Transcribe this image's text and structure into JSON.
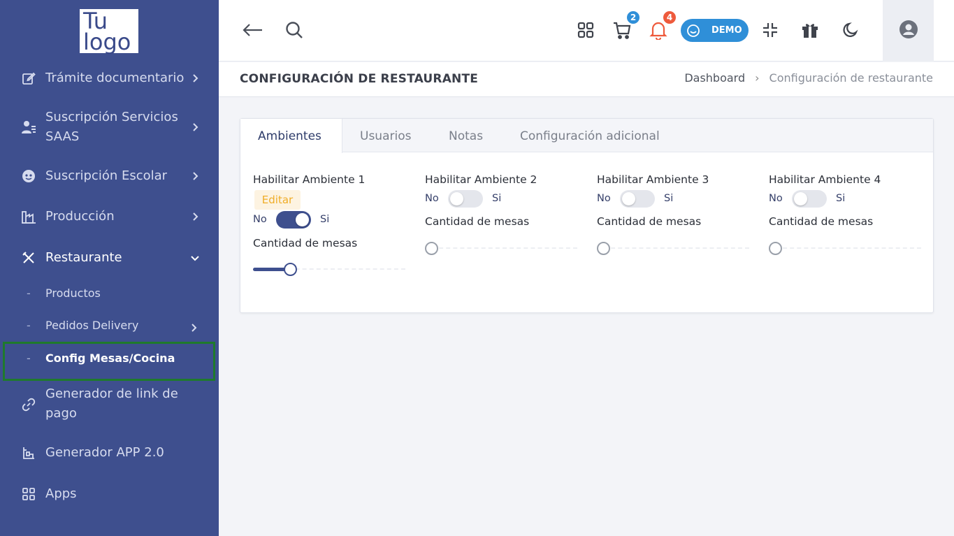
{
  "brand": {
    "logo_line1": "Tu",
    "logo_line2": "logo"
  },
  "sidebar": {
    "items": [
      {
        "label": "Trámite documentario",
        "icon": "edit-document-icon"
      },
      {
        "label": "Suscripción Servicios SAAS",
        "icon": "user-list-icon"
      },
      {
        "label": "Suscripción Escolar",
        "icon": "student-icon"
      },
      {
        "label": "Producción",
        "icon": "factory-icon"
      },
      {
        "label": "Restaurante",
        "icon": "fork-knife-icon"
      },
      {
        "label": "Generador de link de pago",
        "icon": "link-icon"
      },
      {
        "label": "Generador APP 2.0",
        "icon": "app-builder-icon"
      },
      {
        "label": "Apps",
        "icon": "apps-grid-icon"
      }
    ],
    "sub_items": [
      {
        "label": "Productos"
      },
      {
        "label": "Pedidos Delivery"
      },
      {
        "label": "Config Mesas/Cocina"
      }
    ],
    "sub_dash": "-"
  },
  "topbar": {
    "cart_count": "2",
    "notif_count": "4",
    "demo_label": "DEMO",
    "colors": {
      "badge_blue": "#2f8fd8",
      "badge_red": "#ee5a3c"
    }
  },
  "page": {
    "title": "CONFIGURACIÓN DE RESTAURANTE",
    "breadcrumb": {
      "home": "Dashboard",
      "sep": "›",
      "current": "Configuración de restaurante"
    }
  },
  "tabs": [
    {
      "label": "Ambientes",
      "active": true
    },
    {
      "label": "Usuarios",
      "active": false
    },
    {
      "label": "Notas",
      "active": false
    },
    {
      "label": "Configuración adicional",
      "active": false
    }
  ],
  "ambientes": [
    {
      "title": "Habilitar Ambiente 1",
      "edit_label": "Editar",
      "no_label": "No",
      "si_label": "Si",
      "enabled": true,
      "qty_label": "Cantidad de mesas",
      "qty_fraction": 0.22
    },
    {
      "title": "Habilitar Ambiente 2",
      "no_label": "No",
      "si_label": "Si",
      "enabled": false,
      "qty_label": "Cantidad de mesas",
      "qty_fraction": 0
    },
    {
      "title": "Habilitar Ambiente 3",
      "no_label": "No",
      "si_label": "Si",
      "enabled": false,
      "qty_label": "Cantidad de mesas",
      "qty_fraction": 0
    },
    {
      "title": "Habilitar Ambiente 4",
      "no_label": "No",
      "si_label": "Si",
      "enabled": false,
      "qty_label": "Cantidad de mesas",
      "qty_fraction": 0
    }
  ]
}
